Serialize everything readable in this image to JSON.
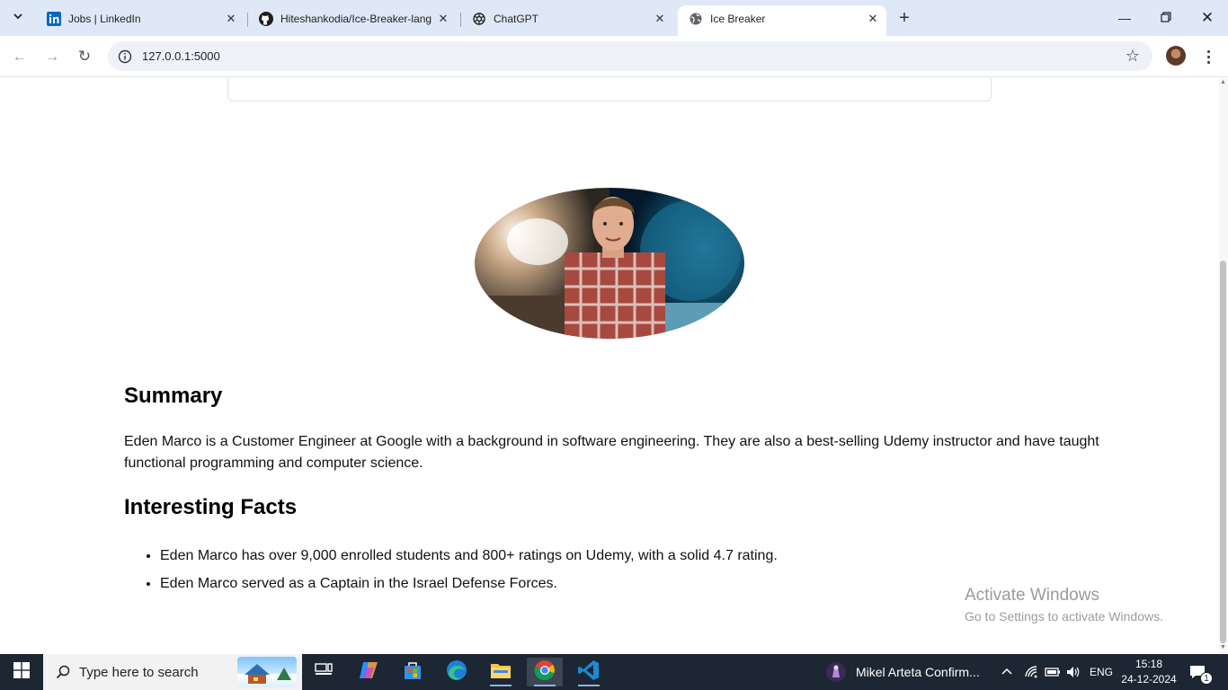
{
  "browser": {
    "tabs": [
      {
        "title": "Jobs | LinkedIn",
        "icon": "linkedin-icon"
      },
      {
        "title": "Hiteshankodia/Ice-Breaker-lang",
        "icon": "github-icon"
      },
      {
        "title": "ChatGPT",
        "icon": "chatgpt-icon"
      },
      {
        "title": "Ice Breaker",
        "icon": "globe-icon",
        "active": true
      }
    ],
    "url": "127.0.0.1:5000"
  },
  "page": {
    "summary_heading": "Summary",
    "summary_text": "Eden Marco is a Customer Engineer at Google with a background in software engineering. They are also a best-selling Udemy instructor and have taught functional programming and computer science.",
    "facts_heading": "Interesting Facts",
    "facts": [
      "Eden Marco has over 9,000 enrolled students and 800+ ratings on Udemy, with a solid 4.7 rating.",
      "Eden Marco served as a Captain in the Israel Defense Forces."
    ]
  },
  "watermark": {
    "line1": "Activate Windows",
    "line2": "Go to Settings to activate Windows."
  },
  "taskbar": {
    "search_placeholder": "Type here to search",
    "notification": "Mikel Arteta Confirm...",
    "language": "ENG",
    "time": "15:18",
    "date": "24-12-2024",
    "notification_count": "1"
  }
}
